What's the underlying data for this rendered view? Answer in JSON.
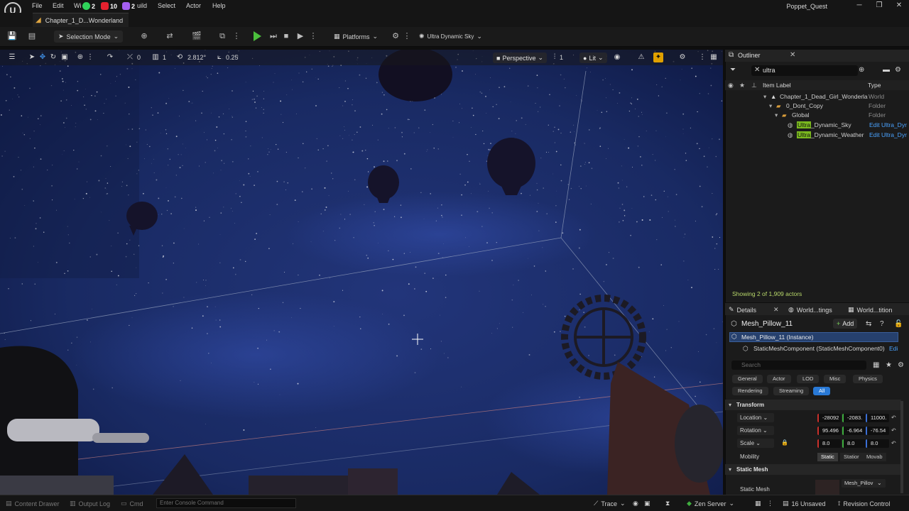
{
  "menu": {
    "items": [
      "File",
      "Edit",
      "Window",
      "Build",
      "Select",
      "Actor",
      "Help"
    ],
    "window_partial": "Wi",
    "build_partial": "uild",
    "overlay_badges": [
      {
        "count": "2",
        "color": "#2fd35a"
      },
      {
        "count": "10",
        "color": "#e5212e"
      },
      {
        "count": "2",
        "color": "#a45ff0"
      }
    ],
    "project_name": "Poppet_Quest"
  },
  "level_tab": {
    "label": "Chapter_1_D...Wonderland"
  },
  "toolbar": {
    "selection_mode": "Selection Mode",
    "platforms": "Platforms",
    "ultra_dynamic_sky": "Ultra Dynamic Sky"
  },
  "viewport_toolbar": {
    "rotation_snap": "0",
    "scale_snap": "1",
    "camera_speed": "2.812°",
    "grid_value": "0.25",
    "perspective": "Perspective",
    "view_count": "1",
    "lit": "Lit"
  },
  "outliner": {
    "title": "Outliner",
    "search_value": "ultra",
    "col_item_label": "Item Label",
    "col_type": "Type",
    "rows": [
      {
        "label": "Chapter_1_Dead_Girl_Wonderla",
        "type": "World"
      },
      {
        "label": "0_Dont_Copy",
        "type": "Folder"
      },
      {
        "label": "Global",
        "type": "Folder"
      },
      {
        "highlight": "Ultra",
        "rest": "_Dynamic_Sky",
        "type": "Edit Ultra_Dyr"
      },
      {
        "highlight": "Ultra",
        "rest": "_Dynamic_Weather",
        "type": "Edit Ultra_Dyr"
      }
    ],
    "footer": "Showing 2 of 1,909 actors"
  },
  "details": {
    "tabs": [
      "Details",
      "World...tings",
      "World...tition"
    ],
    "actor_name": "Mesh_Pillow_11",
    "add_label": "Add",
    "instance_label": "Mesh_Pillow_11 (Instance)",
    "component_label": "StaticMeshComponent (StaticMeshComponent0)",
    "component_edit": "Edi",
    "search_placeholder": "Search",
    "filters_row1": [
      "General",
      "Actor",
      "LOD",
      "Misc",
      "Physics"
    ],
    "filters_row2": [
      "Rendering",
      "Streaming",
      "All"
    ],
    "transform_title": "Transform",
    "location_label": "Location",
    "location": [
      "-28092",
      "-2083.",
      "11000."
    ],
    "rotation_label": "Rotation",
    "rotation": [
      "95.496",
      "-6.964",
      "-76.54"
    ],
    "scale_label": "Scale",
    "scale": [
      "8.0",
      "8.0",
      "8.0"
    ],
    "mobility_label": "Mobility",
    "mobility_options": [
      "Static",
      "Statior",
      "Movab"
    ],
    "static_mesh_title": "Static Mesh",
    "static_mesh_label": "Static Mesh",
    "static_mesh_value": "Mesh_Pillov"
  },
  "statusbar": {
    "content_drawer": "Content Drawer",
    "output_log": "Output Log",
    "cmd": "Cmd",
    "console_placeholder": "Enter Console Command",
    "trace": "Trace",
    "zen_server": "Zen Server",
    "unsaved": "16 Unsaved",
    "revision_control": "Revision Control"
  }
}
